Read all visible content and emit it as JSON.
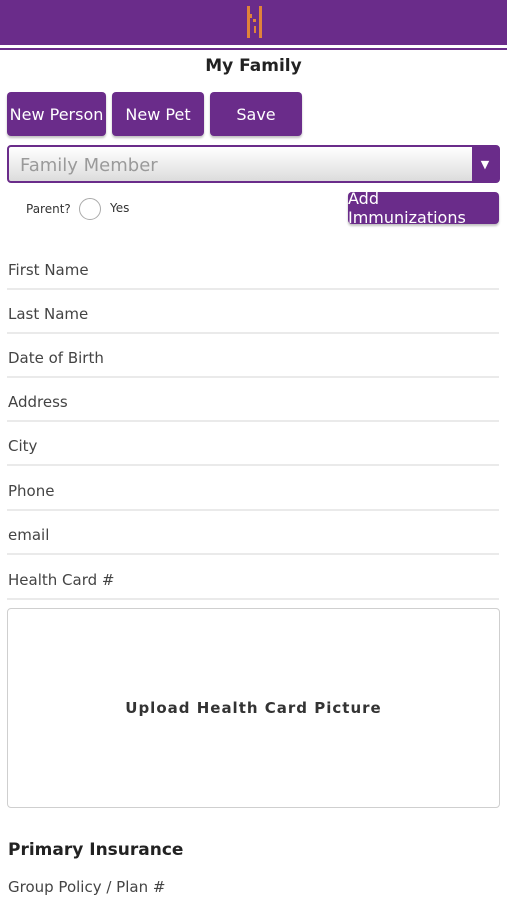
{
  "header": {
    "logo_icon": "h-logo-icon",
    "bar_color": "#6a2c8a",
    "logo_color": "#e0833a"
  },
  "page": {
    "title": "My Family"
  },
  "toolbar": {
    "new_person_label": "New Person",
    "new_pet_label": "New Pet",
    "save_label": "Save"
  },
  "member_select": {
    "placeholder": "Family Member",
    "arrow_icon": "triangle-down-icon"
  },
  "parent": {
    "label": "Parent?",
    "option_label": "Yes",
    "checked": false
  },
  "add_immunizations_label": "Add Immunizations",
  "fields": [
    {
      "label": "First Name"
    },
    {
      "label": "Last Name"
    },
    {
      "label": "Date of Birth"
    },
    {
      "label": "Address"
    },
    {
      "label": "City"
    },
    {
      "label": "Phone"
    },
    {
      "label": "email"
    },
    {
      "label": "Health Card #"
    }
  ],
  "upload": {
    "label": "Upload Health Card Picture"
  },
  "insurance": {
    "section_title": "Primary Insurance",
    "group_policy_label": "Group Policy / Plan #"
  }
}
